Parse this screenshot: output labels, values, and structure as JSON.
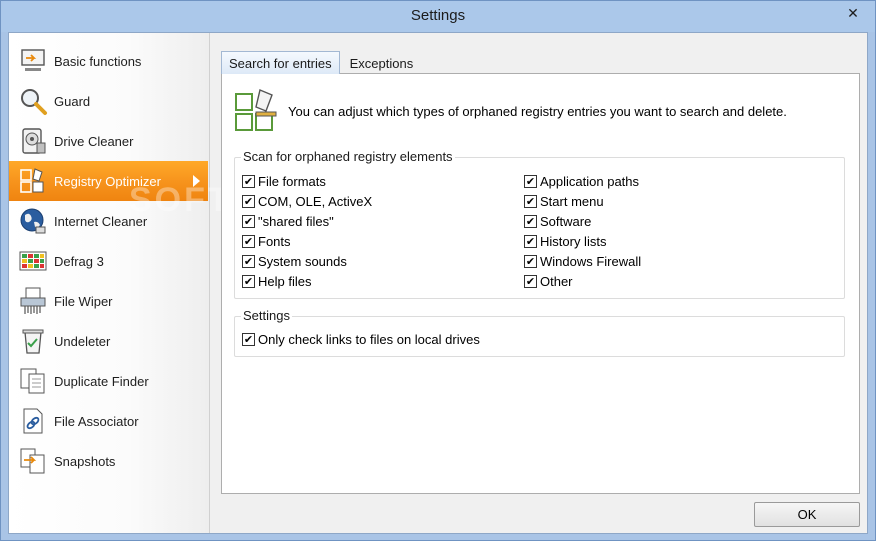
{
  "window": {
    "title": "Settings",
    "close_glyph": "✕"
  },
  "sidebar": {
    "items": [
      {
        "label": "Basic functions",
        "icon": "basic-functions-icon"
      },
      {
        "label": "Guard",
        "icon": "magnifier-icon"
      },
      {
        "label": "Drive Cleaner",
        "icon": "drive-icon"
      },
      {
        "label": "Registry Optimizer",
        "icon": "registry-icon",
        "active": true
      },
      {
        "label": "Internet Cleaner",
        "icon": "globe-icon"
      },
      {
        "label": "Defrag 3",
        "icon": "defrag-icon"
      },
      {
        "label": "File Wiper",
        "icon": "shredder-icon"
      },
      {
        "label": "Undeleter",
        "icon": "recycle-bin-icon"
      },
      {
        "label": "Duplicate Finder",
        "icon": "duplicate-icon"
      },
      {
        "label": "File Associator",
        "icon": "file-link-icon"
      },
      {
        "label": "Snapshots",
        "icon": "snapshot-icon"
      }
    ]
  },
  "tabs": [
    {
      "label": "Search for entries",
      "active": true
    },
    {
      "label": "Exceptions",
      "active": false
    }
  ],
  "intro": {
    "text": "You can adjust which types of orphaned registry entries you want to search and delete."
  },
  "scan_group": {
    "legend": "Scan for orphaned registry elements",
    "left": [
      {
        "label": "File formats",
        "checked": true
      },
      {
        "label": "COM, OLE, ActiveX",
        "checked": true
      },
      {
        "label": "\"shared files\"",
        "checked": true
      },
      {
        "label": "Fonts",
        "checked": true
      },
      {
        "label": "System sounds",
        "checked": true
      },
      {
        "label": "Help files",
        "checked": true
      }
    ],
    "right": [
      {
        "label": "Application paths",
        "checked": true
      },
      {
        "label": "Start menu",
        "checked": true
      },
      {
        "label": "Software",
        "checked": true
      },
      {
        "label": "History lists",
        "checked": true
      },
      {
        "label": "Windows Firewall",
        "checked": true
      },
      {
        "label": "Other",
        "checked": true
      }
    ]
  },
  "settings_group": {
    "legend": "Settings",
    "items": [
      {
        "label": "Only check links to files on local drives",
        "checked": true
      }
    ]
  },
  "buttons": {
    "ok": "OK"
  },
  "check_glyph": "✔",
  "watermark": "SOFTPEDIA",
  "colors": {
    "accent": "#f7941d",
    "titlebar": "#abc8ea"
  }
}
